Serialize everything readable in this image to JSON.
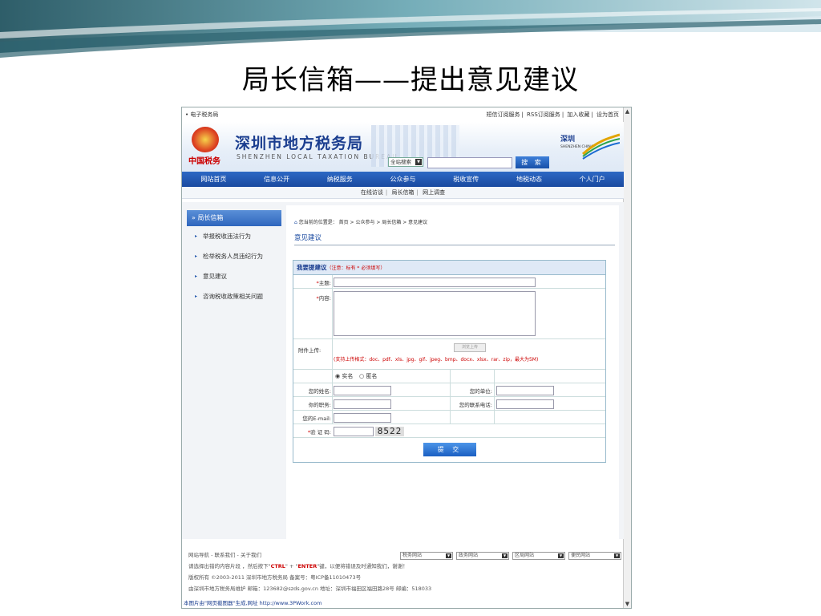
{
  "slide": {
    "title": "局长信箱——提出意见建议"
  },
  "topbar": {
    "left": "• 电子税务局",
    "links": [
      "短信订阅服务",
      "RSS订阅服务",
      "加入收藏",
      "设为首页"
    ]
  },
  "banner": {
    "emblem_text": "中国税务",
    "name": "深圳市地方税务局",
    "name_en": "SHENZHEN LOCAL TAXATION BUREAU",
    "search_scope": "全站搜索",
    "search_button": "搜 索",
    "city_logo": "SHENZHEN CHINA"
  },
  "nav": {
    "items": [
      "网站首页",
      "信息公开",
      "纳税服务",
      "公众参与",
      "税收宣传",
      "地税动态",
      "个人门户"
    ],
    "active": "公众参与"
  },
  "subnav": {
    "items": [
      "在线访谈",
      "局长信箱",
      "网上调查"
    ]
  },
  "sidebar": {
    "header": "局长信箱",
    "items": [
      "举报税收违法行为",
      "检举税务人员违纪行为",
      "意见建议",
      "咨询税收政策相关问题"
    ]
  },
  "main": {
    "breadcrumb": "您当前的位置是： 首页 > 公众参与 > 局长信箱 > 意见建议",
    "page_title": "意见建议"
  },
  "form": {
    "header": "我要提建议",
    "header_note": "（注意：标有 * 必须填写）",
    "subject_label": "主题:",
    "content_label": "内容:",
    "attach_label": "附件上传:",
    "upload_button": "浏览上传",
    "attach_hint": "(支持上传格式：doc、pdf、xls、jpg、gif、jpeg、bmp、docx、xlsx、rar、zip，最大为5M)",
    "radio_real": "实名",
    "radio_anon": "匿名",
    "name_label": "您的姓名:",
    "unit_label": "您的单位:",
    "job_label": "你的职务:",
    "phone_label": "您的联系电话:",
    "email_label": "您的E-mail:",
    "captcha_label": "验 证 码:",
    "captcha_value": "8522",
    "submit": "提 交"
  },
  "footer": {
    "links": "网站导航 - 联系我们 - 关于我们",
    "selects": [
      "税务网站",
      "政务网站",
      "区局网站",
      "便民网站"
    ],
    "line1_a": "请选择出错的内容片段 ，然后按下\"",
    "line1_ctrl": "CTRL",
    "line1_b": "\" + \"",
    "line1_enter": "ENTER",
    "line1_c": "\"键，以便将错误及时通知我们，谢谢！",
    "line2": "版权所有 ©2003-2011 深圳市地方税务局 备案号：粤ICP备11010473号",
    "line3": "由深圳市地方税务局维护 邮箱：123682@szds.gov.cn 地址：深圳市福田区福田路28号 邮编：518033",
    "generator": "本图片由\"网页截图器\"生成,网址 http://www.3PWork.com"
  }
}
